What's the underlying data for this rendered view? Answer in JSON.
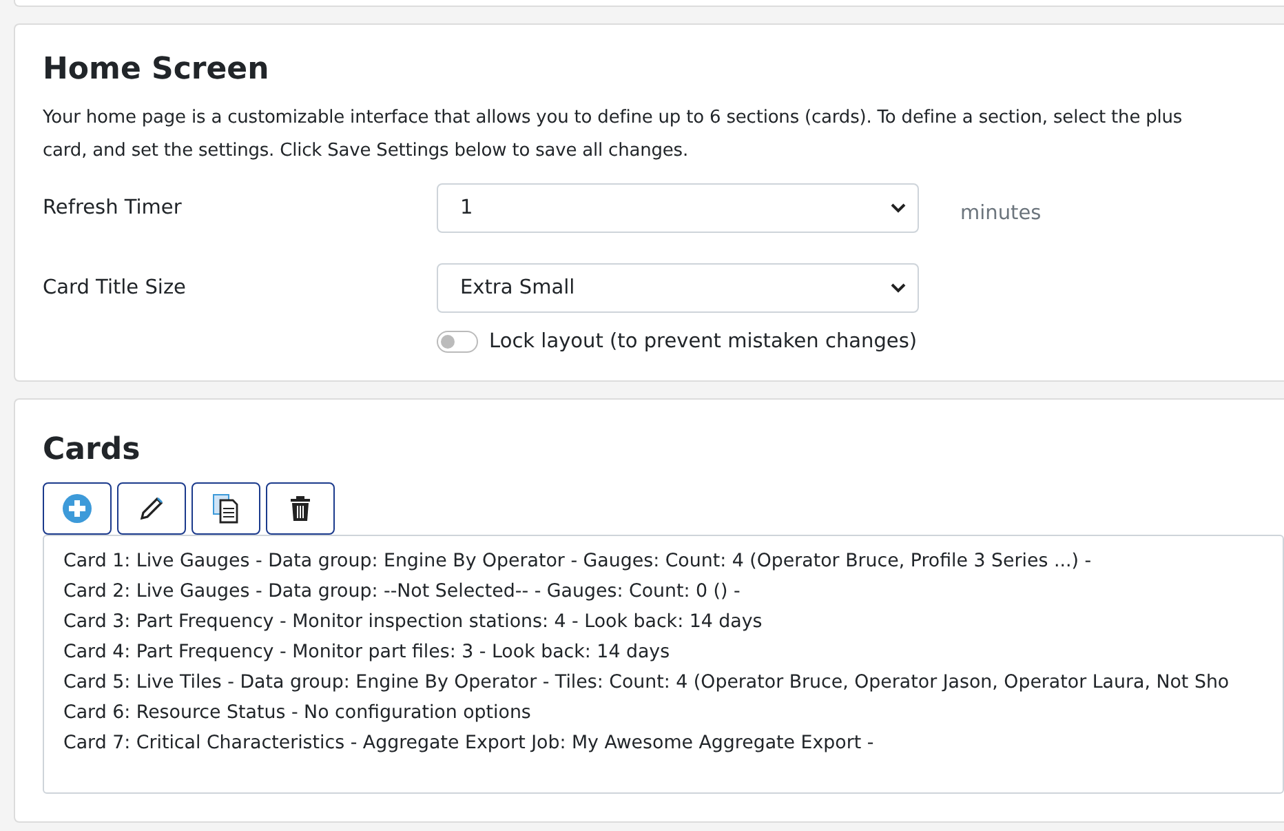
{
  "home_screen": {
    "title": "Home Screen",
    "description_lines": [
      "Your home page is a customizable interface that allows you to define up to 6 sections (cards). To define a section, select the plus",
      "card, and set the settings. Click Save Settings below to save all changes."
    ],
    "fields": [
      {
        "label": "Refresh Timer",
        "value": "1",
        "unit": "minutes"
      },
      {
        "label": "Card Title Size",
        "value": "Extra Small"
      }
    ],
    "lock_layout": {
      "label": "Lock layout (to prevent mistaken changes)",
      "on": false
    }
  },
  "cards": {
    "title": "Cards",
    "toolbar": [
      {
        "kind": "add"
      },
      {
        "kind": "edit"
      },
      {
        "kind": "copy"
      },
      {
        "kind": "delete"
      }
    ],
    "items": [
      "Card 1: Live Gauges - Data group: Engine By Operator - Gauges: Count: 4 (Operator Bruce, Profile 3 Series ...) -",
      "Card 2: Live Gauges - Data group: --Not Selected-- - Gauges: Count: 0 () -",
      "Card 3: Part Frequency - Monitor inspection stations: 4 - Look back: 14 days",
      "Card 4: Part Frequency - Monitor part files: 3 - Look back: 14 days",
      "Card 5: Live Tiles - Data group: Engine By Operator - Tiles: Count: 4 (Operator Bruce, Operator Jason, Operator Laura, Not Sho",
      "Card 6: Resource Status - No configuration options",
      "Card 7: Critical Characteristics - Aggregate Export Job: My Awesome Aggregate Export -"
    ]
  }
}
